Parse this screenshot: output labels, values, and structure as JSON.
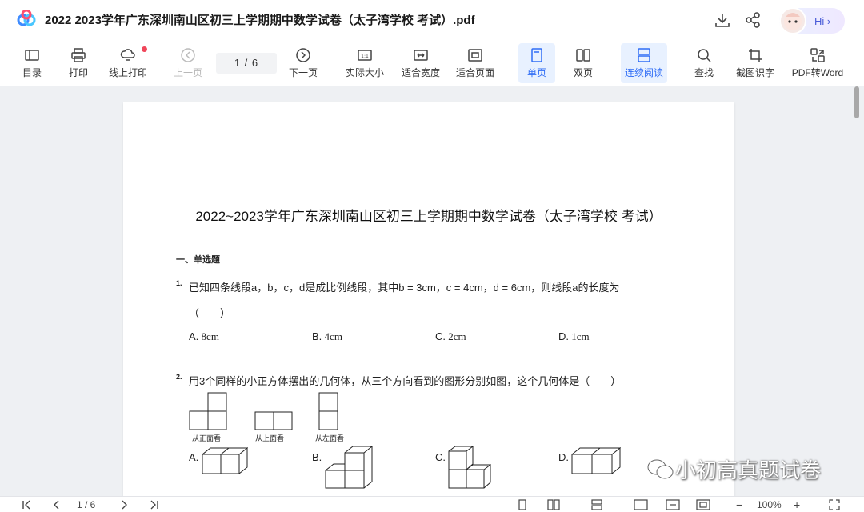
{
  "titlebar": {
    "title": "2022  2023学年广东深圳南山区初三上学期期中数学试卷（太子湾学校 考试）.pdf",
    "hi_label": "Hi ›"
  },
  "toolbar": {
    "items": [
      {
        "label": "目录",
        "icon": "toc-icon"
      },
      {
        "label": "打印",
        "icon": "printer-icon"
      },
      {
        "label": "线上打印",
        "icon": "cloud-print-icon"
      },
      {
        "label": "上一页",
        "icon": "prev-page-icon"
      },
      {
        "label": "下一页",
        "icon": "next-page-icon"
      },
      {
        "label": "实际大小",
        "icon": "actual-size-icon"
      },
      {
        "label": "适合宽度",
        "icon": "fit-width-icon"
      },
      {
        "label": "适合页面",
        "icon": "fit-page-icon"
      },
      {
        "label": "单页",
        "icon": "single-page-icon"
      },
      {
        "label": "双页",
        "icon": "double-page-icon"
      },
      {
        "label": "连续阅读",
        "icon": "continuous-icon"
      },
      {
        "label": "查找",
        "icon": "search-icon"
      },
      {
        "label": "截图识字",
        "icon": "screenshot-ocr-icon"
      },
      {
        "label": "PDF转Word",
        "icon": "pdf-to-word-icon"
      }
    ],
    "page_indicator": "1 / 6"
  },
  "paper": {
    "title": "2022~2023学年广东深圳南山区初三上学期期中数学试卷（太子湾学校 考试）",
    "section": "一、单选题",
    "q1": {
      "num": "1.",
      "text": "已知四条线段a，b，c，d是成比例线段，其中b = 3cm，c = 4cm，d = 6cm，则线段a的长度为",
      "paren": "（　　）",
      "options": [
        {
          "label": "A.",
          "value": "8cm"
        },
        {
          "label": "B.",
          "value": "4cm"
        },
        {
          "label": "C.",
          "value": "2cm"
        },
        {
          "label": "D.",
          "value": "1cm"
        }
      ]
    },
    "q2": {
      "num": "2.",
      "text": "用3个同样的小正方体摆出的几何体，从三个方向看到的图形分别如图，这个几何体是（　　）",
      "views": [
        "从正面看",
        "从上面看",
        "从左面看"
      ],
      "options": [
        "A.",
        "B.",
        "C.",
        "D."
      ]
    }
  },
  "watermark": "小初高真题试卷",
  "statusbar": {
    "page_indicator": "1 / 6",
    "zoom": "100%",
    "minus": "−",
    "plus": "+"
  }
}
